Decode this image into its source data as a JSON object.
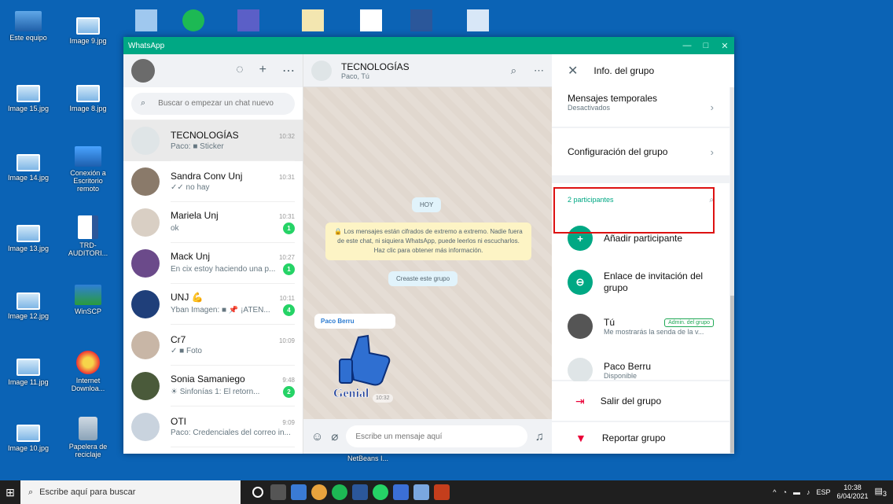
{
  "desktop": {
    "icons": [
      {
        "label": "Este equipo"
      },
      {
        "label": "Image 9.jpg"
      },
      {
        "label": "Image 15.jpg"
      },
      {
        "label": "Image 8.jpg"
      },
      {
        "label": "Image 14.jpg"
      },
      {
        "label": "Conexión a Escritorio remoto"
      },
      {
        "label": "Image 13.jpg"
      },
      {
        "label": "TRD-AUDITORI..."
      },
      {
        "label": "Image 12.jpg"
      },
      {
        "label": "WinSCP"
      },
      {
        "label": "Image 11.jpg"
      },
      {
        "label": "Internet Downloa..."
      },
      {
        "label": "Image 10.jpg"
      },
      {
        "label": "Papelera de reciclaje"
      },
      {
        "label": "NetBeans I..."
      }
    ]
  },
  "window": {
    "title": "WhatsApp",
    "controls": [
      "—",
      "□",
      "✕"
    ]
  },
  "chatlist": {
    "search_placeholder": "Buscar o empezar un chat nuevo",
    "chats": [
      {
        "name": "TECNOLOGÍAS",
        "time": "10:32",
        "last": "Paco: ■ Sticker",
        "badge": "",
        "color": "#dfe5e7"
      },
      {
        "name": "Sandra Conv Unj",
        "time": "10:31",
        "last": "✓✓ no hay",
        "badge": "",
        "color": "#8a7a6a"
      },
      {
        "name": "Mariela Unj",
        "time": "10:31",
        "last": "ok",
        "badge": "1",
        "color": "#d9cfc4"
      },
      {
        "name": "Mack Unj",
        "time": "10:27",
        "last": "En cix estoy haciendo una p...",
        "badge": "1",
        "color": "#6b4a8a"
      },
      {
        "name": "UNJ 💪",
        "time": "10:11",
        "last": "Yban Imagen: ■ 📌 ¡ATEN...",
        "badge": "4",
        "color": "#1f3f7a"
      },
      {
        "name": "Cr7",
        "time": "10:09",
        "last": "✓ ■ Foto",
        "badge": "",
        "color": "#c8b6a6"
      },
      {
        "name": "Sonia Samaniego",
        "time": "9:48",
        "last": "☀ Sinfonías 1: El retorn...",
        "badge": "2",
        "color": "#4a5a3a"
      },
      {
        "name": "OTI",
        "time": "9:09",
        "last": "Paco: Credenciales del correo in...",
        "badge": "",
        "color": "#c9d3de"
      }
    ]
  },
  "conversation": {
    "title": "TECNOLOGÍAS",
    "subtitle": "Paco, Tú",
    "day": "HOY",
    "system_msg": "🔒 Los mensajes están cifrados de extremo a extremo. Nadie fuera de este chat, ni siquiera WhatsApp, puede leerlos ni escucharlos. Haz clic para obtener más información.",
    "created": "Creaste este grupo",
    "sender": "Paco Berru",
    "sticker_text": "Genial",
    "sticker_time": "10:32",
    "compose_placeholder": "Escribe un mensaje aquí"
  },
  "info": {
    "title": "Info. del grupo",
    "temp_label": "Mensajes temporales",
    "temp_value": "Desactivados",
    "config_label": "Configuración del grupo",
    "participants_count": "2 participantes",
    "add_participant": "Añadir participante",
    "invite_link": "Enlace de invitación del grupo",
    "participants": [
      {
        "name": "Tú",
        "status": "Me mostrarás la senda de la v...",
        "tag": "Admin. del grupo",
        "color": "#555"
      },
      {
        "name": "Paco Berru",
        "status": "Disponible",
        "tag": "",
        "color": "#dfe5e7"
      }
    ],
    "exit_group": "Salir del grupo",
    "report_group": "Reportar grupo"
  },
  "taskbar": {
    "search_placeholder": "Escribe aquí para buscar",
    "lang": "ESP",
    "time": "10:38",
    "date": "6/04/2021",
    "notif_count": "3"
  }
}
